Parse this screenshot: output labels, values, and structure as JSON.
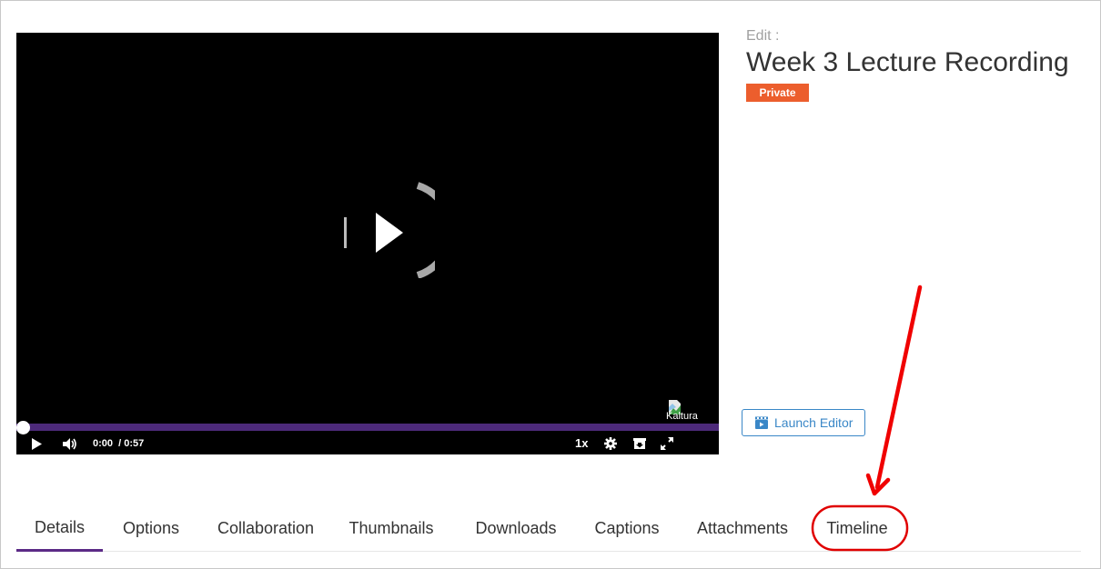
{
  "player": {
    "current_time": "0:00",
    "duration": "/ 0:57",
    "speed": "1x",
    "progress": 0,
    "logo_alt": "Kaltura",
    "icons": {
      "big_play": "play-icon",
      "play": "play-icon",
      "volume": "volume-icon",
      "settings": "gear-icon",
      "download": "download-icon",
      "fullscreen": "fullscreen-icon",
      "logo": "broken-image-icon"
    },
    "progress_color": "#4d2a7a"
  },
  "header": {
    "edit_label": "Edit :",
    "title": "Week 3 Lecture Recording",
    "badge": "Private",
    "badge_color": "#ec5e2d"
  },
  "launch_editor": {
    "label": "Launch Editor",
    "icon": "clapperboard-icon",
    "color": "#3a87c7"
  },
  "tabs": [
    {
      "label": "Details",
      "active": true
    },
    {
      "label": "Options",
      "active": false
    },
    {
      "label": "Collaboration",
      "active": false
    },
    {
      "label": "Thumbnails",
      "active": false
    },
    {
      "label": "Downloads",
      "active": false
    },
    {
      "label": "Captions",
      "active": false
    },
    {
      "label": "Attachments",
      "active": false
    },
    {
      "label": "Timeline",
      "active": false
    }
  ],
  "annotation": {
    "highlight_target": "Timeline",
    "color": "#e00000"
  }
}
